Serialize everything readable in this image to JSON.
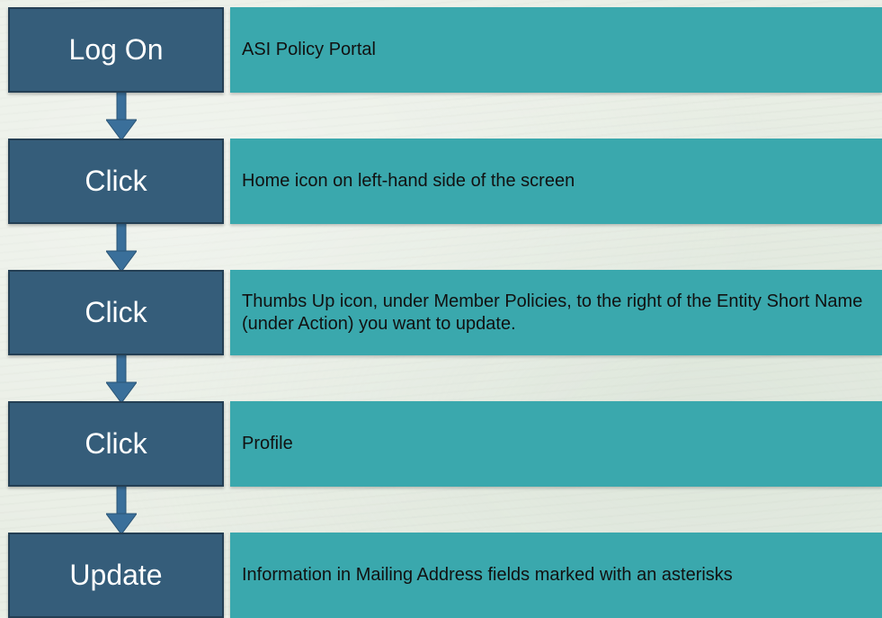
{
  "colors": {
    "step_fill": "#355d7a",
    "step_border": "#243f54",
    "desc_fill": "#3aa8ad",
    "arrow": "#3a6f9a",
    "background": "#e9eee5"
  },
  "steps": [
    {
      "action": "Log On",
      "description": "ASI Policy Portal"
    },
    {
      "action": "Click",
      "description": "Home icon on left-hand side of the screen"
    },
    {
      "action": "Click",
      "description": "Thumbs Up icon, under Member Policies, to the right of the Entity Short Name (under Action) you want to update."
    },
    {
      "action": "Click",
      "description": "Profile"
    },
    {
      "action": "Update",
      "description": "Information in Mailing Address fields marked with an asterisks"
    }
  ],
  "arrows": [
    "down-arrow-icon",
    "down-arrow-icon",
    "down-arrow-icon",
    "down-arrow-icon"
  ]
}
